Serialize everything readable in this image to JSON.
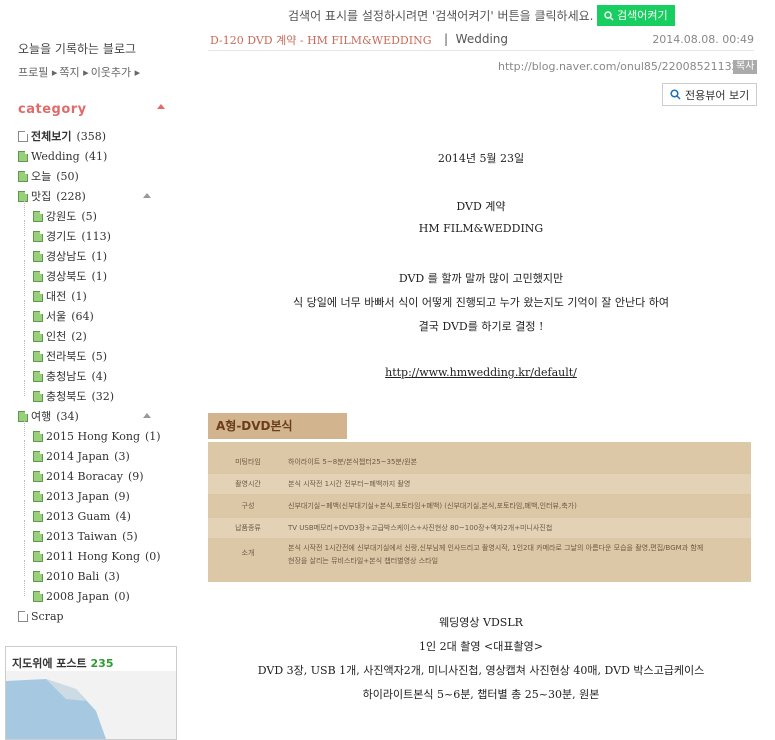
{
  "topbar": {
    "message": "검색어 표시를 설정하시려면 '검색어켜기' 버튼을 클릭하세요.",
    "button": "검색어켜기"
  },
  "sidebar": {
    "blog_desc": "오늘을 기록하는 블로그",
    "profile_links": [
      "프로필",
      "쪽지",
      "이웃추가"
    ],
    "category_title": "category",
    "categories": [
      {
        "label": "전체보기",
        "count": "(358)",
        "level": 0,
        "icon": "doc-icon",
        "bold": true
      },
      {
        "label": "Wedding",
        "count": "(41)",
        "level": 0,
        "icon": "folder-icon"
      },
      {
        "label": "오늘",
        "count": "(50)",
        "level": 0,
        "icon": "folder-icon"
      },
      {
        "label": "맛집",
        "count": "(228)",
        "level": 0,
        "icon": "folder-icon",
        "toggle": "collapse"
      },
      {
        "label": "강원도",
        "count": "(5)",
        "level": 1,
        "icon": "folder-icon"
      },
      {
        "label": "경기도",
        "count": "(113)",
        "level": 1,
        "icon": "folder-icon"
      },
      {
        "label": "경상남도",
        "count": "(1)",
        "level": 1,
        "icon": "folder-icon"
      },
      {
        "label": "경상북도",
        "count": "(1)",
        "level": 1,
        "icon": "folder-icon"
      },
      {
        "label": "대전",
        "count": "(1)",
        "level": 1,
        "icon": "folder-icon"
      },
      {
        "label": "서울",
        "count": "(64)",
        "level": 1,
        "icon": "folder-icon"
      },
      {
        "label": "인천",
        "count": "(2)",
        "level": 1,
        "icon": "folder-icon"
      },
      {
        "label": "전라북도",
        "count": "(5)",
        "level": 1,
        "icon": "folder-icon"
      },
      {
        "label": "충청남도",
        "count": "(4)",
        "level": 1,
        "icon": "folder-icon"
      },
      {
        "label": "충청북도",
        "count": "(32)",
        "level": 1,
        "icon": "folder-icon"
      },
      {
        "label": "여행",
        "count": "(34)",
        "level": 0,
        "icon": "folder-icon",
        "toggle": "collapse"
      },
      {
        "label": "2015 Hong Kong",
        "count": "(1)",
        "level": 1,
        "icon": "folder-icon"
      },
      {
        "label": "2014 Japan",
        "count": "(3)",
        "level": 1,
        "icon": "folder-icon"
      },
      {
        "label": "2014 Boracay",
        "count": "(9)",
        "level": 1,
        "icon": "folder-icon"
      },
      {
        "label": "2013 Japan",
        "count": "(9)",
        "level": 1,
        "icon": "folder-icon"
      },
      {
        "label": "2013 Guam",
        "count": "(4)",
        "level": 1,
        "icon": "folder-icon"
      },
      {
        "label": "2013 Taiwan",
        "count": "(5)",
        "level": 1,
        "icon": "folder-icon"
      },
      {
        "label": "2011 Hong Kong",
        "count": "(0)",
        "level": 1,
        "icon": "folder-icon"
      },
      {
        "label": "2010 Bali",
        "count": "(3)",
        "level": 1,
        "icon": "folder-icon"
      },
      {
        "label": "2008 Japan",
        "count": "(0)",
        "level": 1,
        "icon": "folder-icon"
      },
      {
        "label": "Scrap",
        "count": "",
        "level": 0,
        "icon": "doc-icon"
      }
    ],
    "map_widget": {
      "title": "지도위에 포스트",
      "count": "235"
    }
  },
  "post": {
    "title": "D-120 DVD 계약 - HM FILM&WEDDING",
    "category": "Wedding",
    "date": "2014.08.08. 00:49",
    "url": "http://blog.naver.com/onul85/220085211327",
    "copy_label": "복사",
    "viewer_button": "전용뷰어 보기",
    "lines": [
      "2014년 5월 23일",
      "DVD 계약",
      "HM FILM&WEDDING",
      "DVD 를 할까 말까 많이 고민했지만",
      "식 당일에 너무 바빠서 식이 어떻게 진행되고 누가 왔는지도 기억이 잘 안난다 하여",
      "결국 DVD를 하기로 결정 !"
    ],
    "link": "http://www.hmwedding.kr/default/",
    "panel_title": "A형-DVD본식",
    "panel_rows": [
      {
        "k": "미팅타임",
        "v": "하이라이트 5~8분/본식챕터25~35분/원본"
      },
      {
        "k": "촬영시간",
        "v": "본식 시작전 1시간 전부터~폐백까지 촬영"
      },
      {
        "k": "구성",
        "v": "신부대기실~폐백(신부대기실+본식,포토타임+폐백) (신부대기실,본식,포토타임,폐백,인터뷰,축가)"
      },
      {
        "k": "납품종류",
        "v": "TV USB메모리+DVD3장+고급박스케이스+사진현상 80~100장+액자2개+미니사진첩"
      },
      {
        "k": "소개",
        "v": "본식 시작전 1시간전에 신부대기실에서 신랑,신부님께 인사드리고 촬영시작, 1인2대 카메라로 그날의 아름다운 모습을 촬영,편집/BGM과 함께 현장을 살리는 뮤비스타일+본식 챕터별영상 스타일"
      }
    ],
    "lines2": [
      "웨딩영상 VDSLR",
      "1인 2대 촬영 <대표촬영>",
      "DVD 3장, USB 1개, 사진액자2개, 미니사진첩, 영상캡쳐 사진현상 40매, DVD 박스고급케이스",
      "하이라이트본식 5~6분, 챕터별 총 25~30분, 원본"
    ]
  },
  "colors": {
    "accent_green": "#19ce60",
    "category_red": "#e16a6a",
    "panel_tan": "#dcc7a6"
  }
}
